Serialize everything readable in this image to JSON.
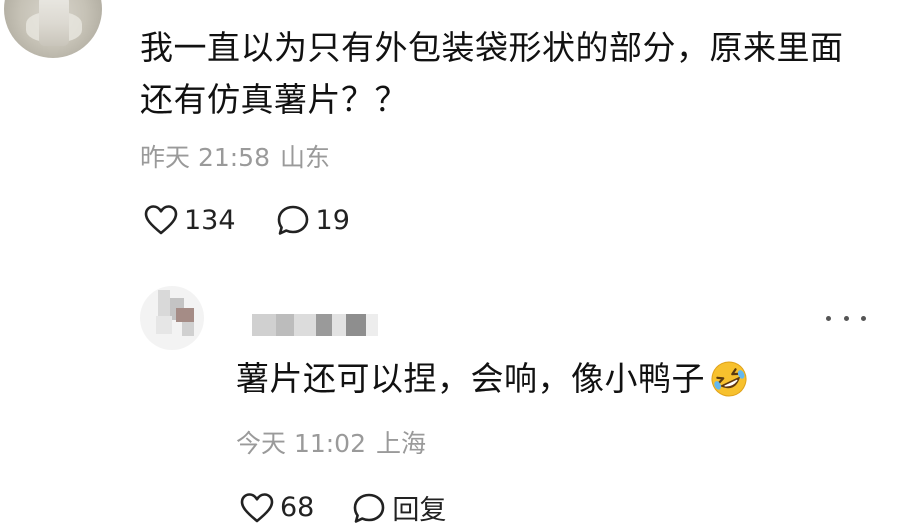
{
  "main_comment": {
    "text": "我一直以为只有外包装袋形状的部分，原来里面还有仿真薯片？？",
    "time": "昨天 21:58",
    "location": "山东",
    "likes": "134",
    "comments": "19"
  },
  "reply": {
    "username_redacted": true,
    "text": "薯片还可以捏，会响，像小鸭子",
    "emoji": "rolling-on-the-floor-laughing",
    "time": "今天 11:02",
    "location": "上海",
    "likes": "68",
    "reply_label": "回复"
  },
  "icons": {
    "like": "heart-outline-icon",
    "comment": "speech-bubble-icon",
    "more": "more-dots-icon"
  },
  "colors": {
    "text": "#111111",
    "meta": "#9a9a9a",
    "background": "#ffffff"
  }
}
